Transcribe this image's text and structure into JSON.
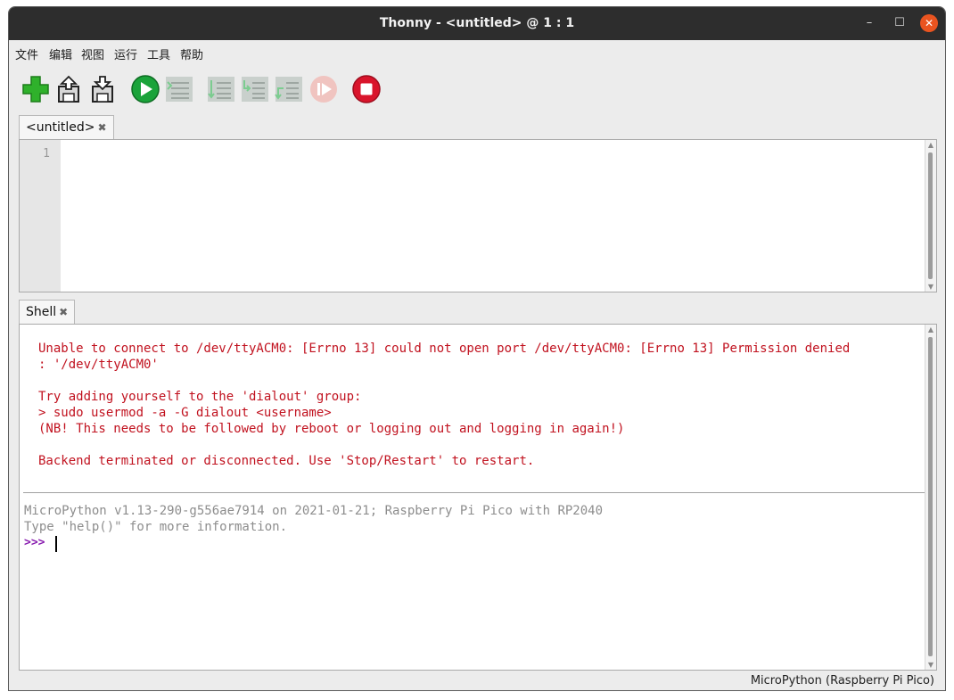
{
  "window": {
    "title": "Thonny  -  <untitled>  @  1 : 1",
    "minimize": "–",
    "maximize": "☐",
    "close": "✕"
  },
  "menu": [
    "文件",
    "编辑",
    "视图",
    "运行",
    "工具",
    "帮助"
  ],
  "toolbar": {
    "icons": [
      "new-file-icon",
      "open-file-icon",
      "save-file-icon",
      "run-icon",
      "debug-icon",
      "step-over-icon",
      "step-into-icon",
      "step-out-icon",
      "resume-icon",
      "stop-icon"
    ]
  },
  "colors": {
    "error": "#c1121f",
    "info": "#8d8d8d",
    "prompt": "#8a1fb0",
    "run": "#1aa33a",
    "stop": "#d9142b",
    "close_button": "#e95420"
  },
  "editor": {
    "tab_label": "<untitled>",
    "tab_close": "✖",
    "line_numbers": [
      "1"
    ]
  },
  "shell": {
    "tab_label": "Shell",
    "tab_close": "✖",
    "error_lines": [
      "Unable to connect to /dev/ttyACM0: [Errno 13] could not open port /dev/ttyACM0: [Errno 13] Permission denied",
      ": '/dev/ttyACM0'",
      "",
      "Try adding yourself to the 'dialout' group:",
      "> sudo usermod -a -G dialout <username>",
      "(NB! This needs to be followed by reboot or logging out and logging in again!)",
      "",
      "Backend terminated or disconnected. Use 'Stop/Restart' to restart."
    ],
    "info_lines": [
      "MicroPython v1.13-290-g556ae7914 on 2021-01-21; Raspberry Pi Pico with RP2040",
      "Type \"help()\" for more information."
    ],
    "prompt": ">>>"
  },
  "status": {
    "interpreter": "MicroPython (Raspberry Pi Pico)"
  }
}
